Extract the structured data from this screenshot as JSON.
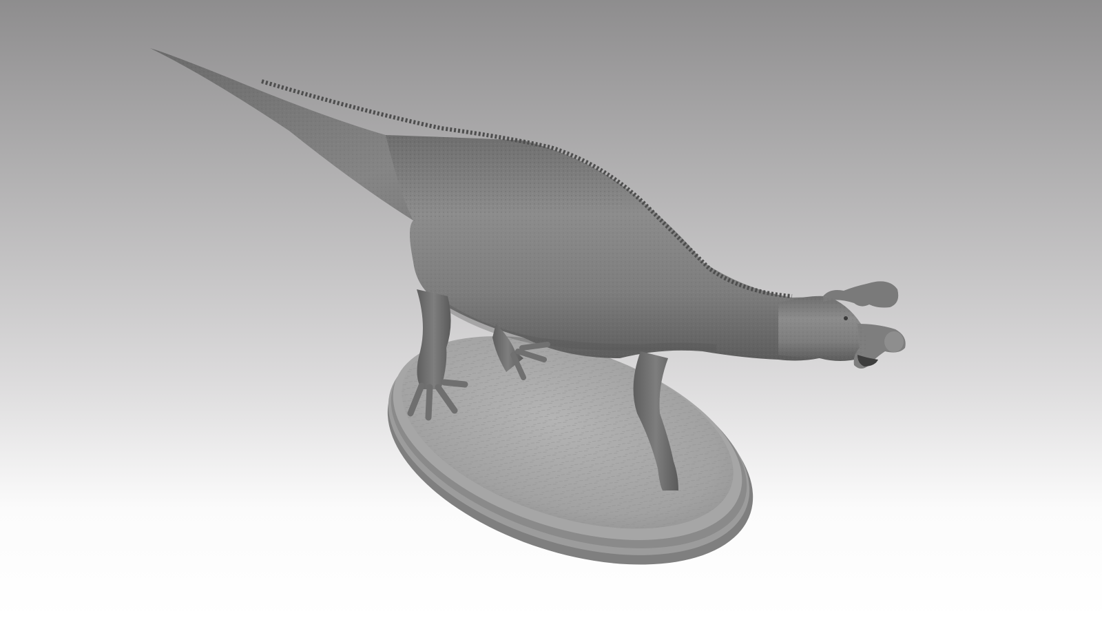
{
  "viewport": {
    "background_top": "#8e8d8e",
    "background_bottom": "#ffffff"
  },
  "model": {
    "subject": "dinosaur-sculpt",
    "material_color": "#8a8a8a",
    "base_color": "#a9a9a9"
  }
}
